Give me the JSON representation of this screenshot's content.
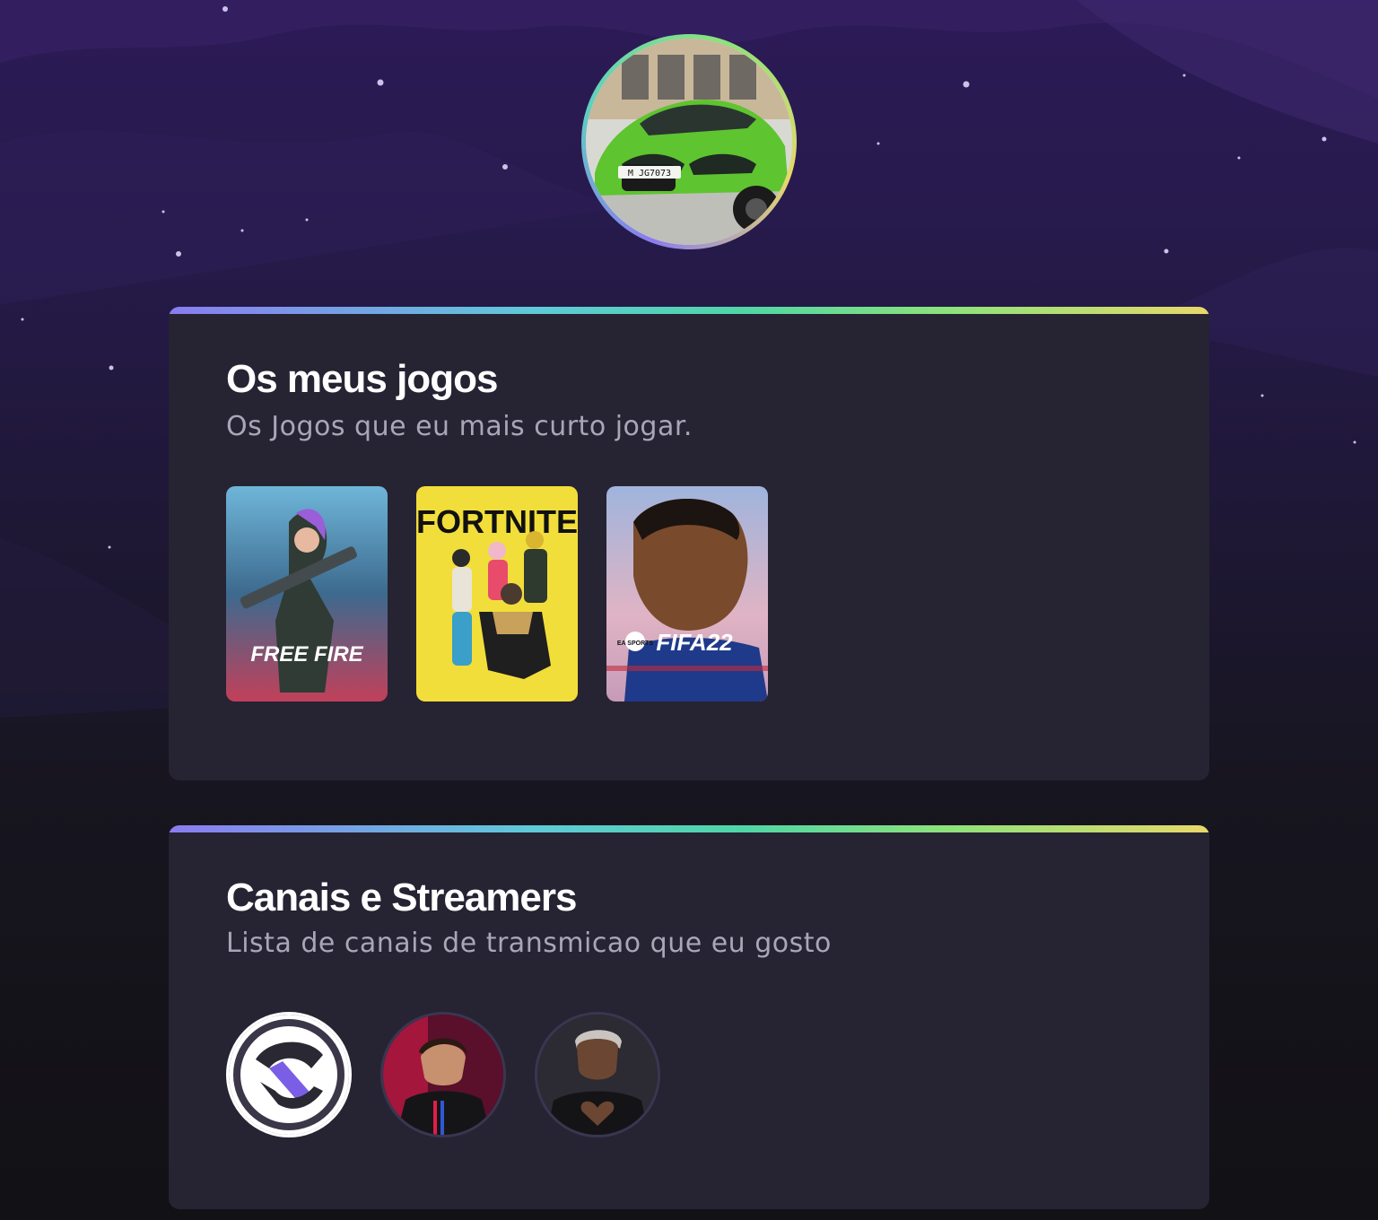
{
  "profile": {
    "avatar_icon": "green-car-photo",
    "plate_text": "M JG7073"
  },
  "games_section": {
    "title": "Os meus jogos",
    "subtitle": "Os Jogos que eu mais curto jogar.",
    "games": [
      {
        "label": "FREE FIRE",
        "icon": "free-fire-cover"
      },
      {
        "label": "FORTNITE",
        "icon": "fortnite-cover"
      },
      {
        "label": "FIFA22",
        "brand": "EA SPORTS",
        "icon": "fifa22-cover"
      }
    ]
  },
  "streamers_section": {
    "title": "Canais e Streamers",
    "subtitle": "Lista de canais de transmicao que eu gosto",
    "streamers": [
      {
        "icon": "streamer-logo-avatar"
      },
      {
        "icon": "streamer-red-photo-avatar"
      },
      {
        "icon": "streamer-heart-photo-avatar"
      }
    ]
  },
  "colors": {
    "accent_gradient": [
      "#8a7cf0",
      "#4fd6a6",
      "#e8d86a"
    ],
    "card_bg": "#262333",
    "page_top": "#2c1a57",
    "page_bottom": "#121115"
  }
}
